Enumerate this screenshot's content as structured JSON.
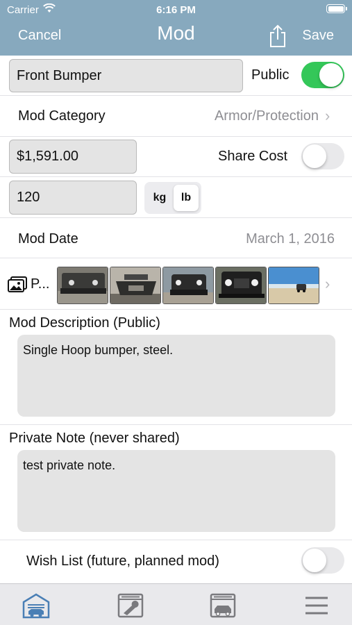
{
  "status": {
    "carrier": "Carrier",
    "time": "6:16 PM"
  },
  "nav": {
    "cancel": "Cancel",
    "title": "Mod",
    "save": "Save"
  },
  "form": {
    "mod_name": "Front Bumper",
    "public_label": "Public",
    "public_on": true,
    "category_label": "Mod Category",
    "category_value": "Armor/Protection",
    "cost_value": "$1,591.00",
    "share_cost_label": "Share Cost",
    "share_cost_on": false,
    "weight_value": "120",
    "unit_options": [
      "kg",
      "lb"
    ],
    "unit_selected": "lb",
    "date_label": "Mod Date",
    "date_value": "March 1, 2016",
    "photos_label": "P...",
    "photo_count": 5,
    "description_label": "Mod Description (Public)",
    "description_value": "Single Hoop bumper, steel.",
    "private_note_label": "Private Note (never shared)",
    "private_note_value": "test private note.",
    "wish_list_label": "Wish List (future, planned mod)",
    "wish_list_on": false
  },
  "tabbar": {
    "items": [
      "garage-icon",
      "wrench-icon",
      "vehicle-icon",
      "menu-icon"
    ],
    "selected": "garage-icon"
  },
  "colors": {
    "header": "#87a9be",
    "toggle_on": "#34c759",
    "tab_active": "#4a7fb5",
    "tab_inactive": "#7a7a7e"
  }
}
